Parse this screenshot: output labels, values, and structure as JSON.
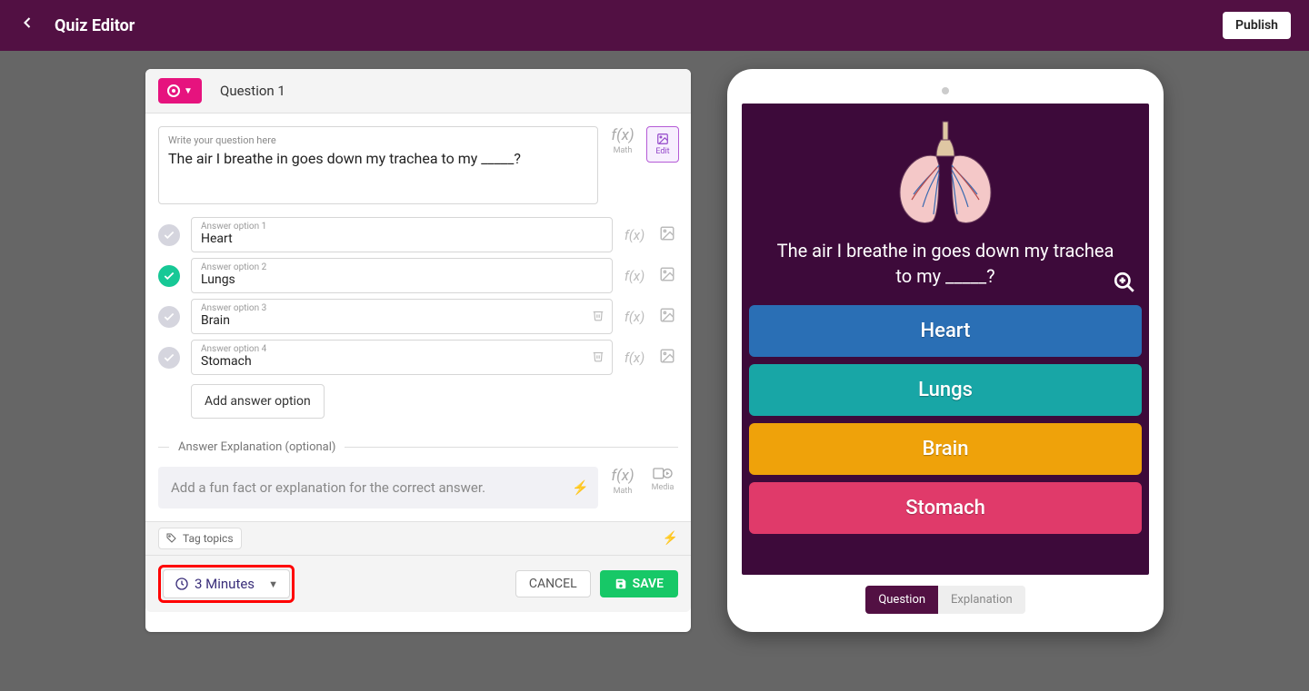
{
  "header": {
    "title": "Quiz Editor",
    "publish_label": "Publish"
  },
  "editor": {
    "question_number": "Question 1",
    "question_placeholder": "Write your question here",
    "question_text": "The air I breathe in goes down my trachea to my _____?",
    "math_label": "Math",
    "edit_label": "Edit",
    "answers": [
      {
        "placeholder": "Answer option 1",
        "value": "Heart",
        "correct": false,
        "trash": false
      },
      {
        "placeholder": "Answer option 2",
        "value": "Lungs",
        "correct": true,
        "trash": false
      },
      {
        "placeholder": "Answer option 3",
        "value": "Brain",
        "correct": false,
        "trash": true
      },
      {
        "placeholder": "Answer option 4",
        "value": "Stomach",
        "correct": false,
        "trash": true
      }
    ],
    "add_option_label": "Add answer option",
    "explanation_heading": "Answer Explanation (optional)",
    "explanation_placeholder": "Add a fun fact or explanation for the correct answer.",
    "media_label": "Media",
    "tag_topics_label": "Tag topics",
    "time_label": "3 Minutes",
    "cancel_label": "CANCEL",
    "save_label": "SAVE"
  },
  "preview": {
    "question_text": "The air I breathe in goes down my trachea to my _____?",
    "answers": [
      "Heart",
      "Lungs",
      "Brain",
      "Stomach"
    ],
    "tab_question": "Question",
    "tab_explanation": "Explanation"
  }
}
